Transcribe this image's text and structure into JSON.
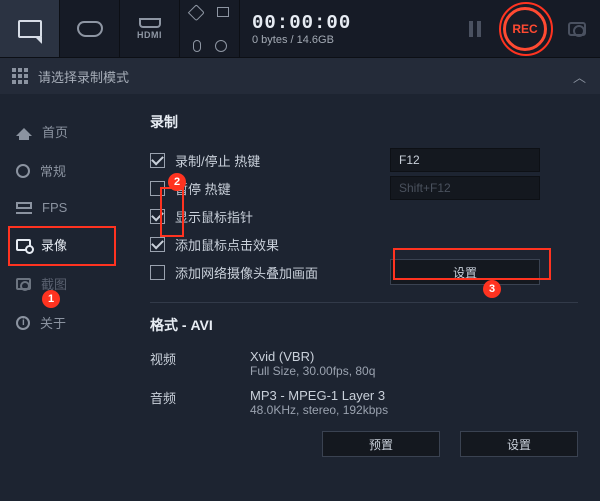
{
  "topbar": {
    "timer": "00:00:00",
    "size_used": "0 bytes",
    "size_total": "14.6GB",
    "rec_label": "REC"
  },
  "modebar": {
    "label": "请选择录制模式"
  },
  "sidebar": {
    "items": [
      {
        "label": "首页"
      },
      {
        "label": "常规"
      },
      {
        "label": "FPS"
      },
      {
        "label": "录像"
      },
      {
        "label": "截图"
      },
      {
        "label": "关于"
      }
    ]
  },
  "record": {
    "title": "录制",
    "chk_record_stop": "录制/停止 热键",
    "hotkey_record": "F12",
    "chk_pause": "暂停 热键",
    "hotkey_pause": "Shift+F12",
    "chk_cursor": "显示鼠标指针",
    "chk_click_effect": "添加鼠标点击效果",
    "chk_webcam_overlay": "添加网络摄像头叠加画面",
    "btn_settings": "设置"
  },
  "format": {
    "title": "格式 - AVI",
    "video_label": "视频",
    "video_codec": "Xvid (VBR)",
    "video_detail": "Full Size, 30.00fps, 80q",
    "audio_label": "音频",
    "audio_codec": "MP3 - MPEG-1 Layer 3",
    "audio_detail": "48.0KHz, stereo, 192kbps",
    "btn_preset": "预置",
    "btn_settings": "设置"
  },
  "annotations": {
    "b1": "1",
    "b2": "2",
    "b3": "3"
  }
}
